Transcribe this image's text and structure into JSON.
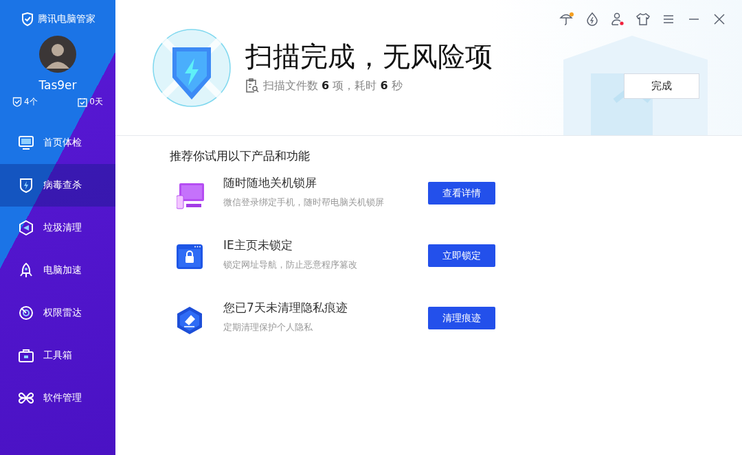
{
  "sidebar": {
    "brand": "腾讯电脑管家",
    "username": "Tas9er",
    "stats": [
      {
        "kind": "shield",
        "label": "4个"
      },
      {
        "kind": "calendar",
        "label": "0天"
      }
    ],
    "items": [
      {
        "kind": "checkup",
        "label": "首页体检",
        "selected": false
      },
      {
        "kind": "antivirus",
        "label": "病毒查杀",
        "selected": true
      },
      {
        "kind": "cleanup",
        "label": "垃圾清理",
        "selected": false
      },
      {
        "kind": "speedup",
        "label": "电脑加速",
        "selected": false
      },
      {
        "kind": "radar",
        "label": "权限雷达",
        "selected": false
      },
      {
        "kind": "toolbox",
        "label": "工具箱",
        "selected": false
      },
      {
        "kind": "software",
        "label": "软件管理",
        "selected": false
      }
    ]
  },
  "title_icons": [
    {
      "kind": "umbrella",
      "color": "#f5a021"
    },
    {
      "kind": "drop"
    },
    {
      "kind": "user",
      "color": "#f0203c"
    },
    {
      "kind": "shirt"
    },
    {
      "kind": "menu"
    },
    {
      "kind": "minimize"
    },
    {
      "kind": "close"
    }
  ],
  "result": {
    "title": "扫描完成，无风险项",
    "summary": "扫描文件数 **6** 项，耗时 **6** 秒",
    "button": "完成"
  },
  "recommend": {
    "heading": "推荐你试用以下产品和功能",
    "items": [
      {
        "kind": "device",
        "title": "随时随地关机锁屏",
        "desc": "微信登录绑定手机，随时帮电脑关机锁屏",
        "button": "查看详情"
      },
      {
        "kind": "browser",
        "title": "IE主页未锁定",
        "desc": "锁定网址导航，防止恶意程序篡改",
        "button": "立即锁定"
      },
      {
        "kind": "eraser",
        "title": "您已7天未清理隐私痕迹",
        "desc": "定期清理保护个人隐私",
        "button": "清理痕迹"
      }
    ]
  }
}
